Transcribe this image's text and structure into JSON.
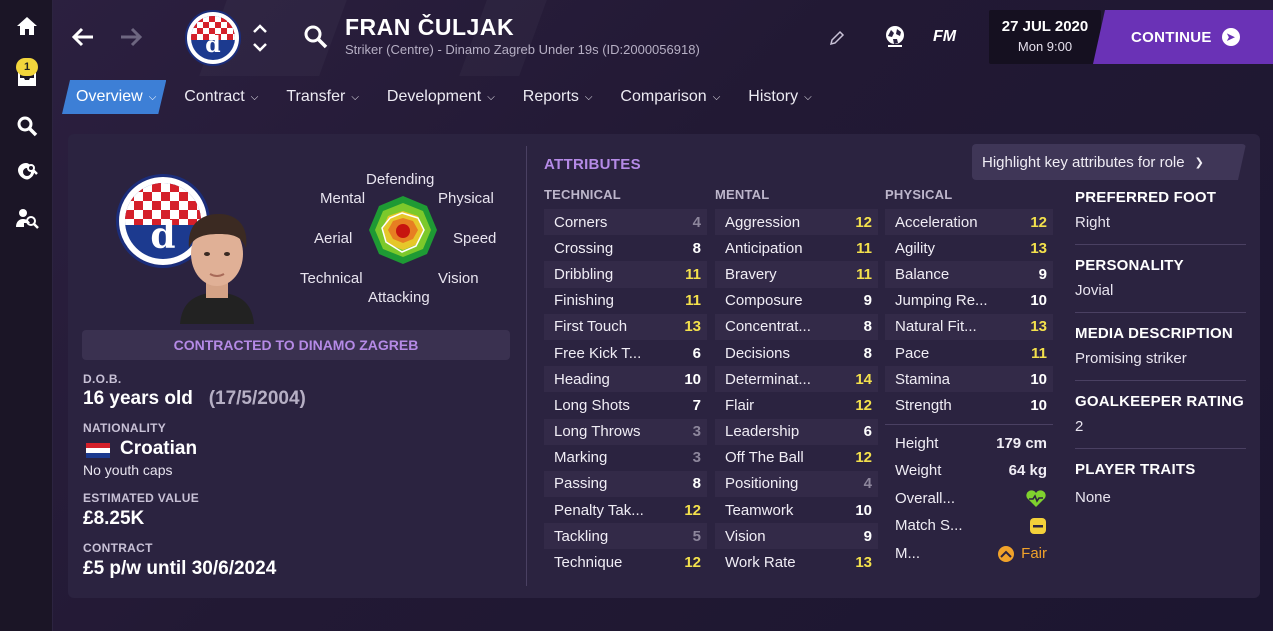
{
  "rail": {
    "badge_count": "1"
  },
  "header": {
    "player_name": "FRAN ČULJAK",
    "player_sub": "Striker (Centre) - Dinamo Zagreb Under 19s (ID:2000056918)",
    "fm_label": "FM",
    "date": "27 JUL 2020",
    "time": "Mon 9:00",
    "continue_label": "CONTINUE"
  },
  "tabs": [
    {
      "label": "Overview",
      "active": true
    },
    {
      "label": "Contract"
    },
    {
      "label": "Transfer"
    },
    {
      "label": "Development"
    },
    {
      "label": "Reports"
    },
    {
      "label": "Comparison"
    },
    {
      "label": "History"
    }
  ],
  "profile": {
    "club_badge_letter": "d",
    "radar_labels": {
      "defending": "Defending",
      "mental": "Mental",
      "physical": "Physical",
      "aerial": "Aerial",
      "speed": "Speed",
      "technical": "Technical",
      "vision": "Vision",
      "attacking": "Attacking"
    },
    "contract_banner": "CONTRACTED TO DINAMO ZAGREB",
    "dob_label": "D.O.B.",
    "age": "16 years old",
    "dob": "(17/5/2004)",
    "nationality_label": "NATIONALITY",
    "nationality": "Croatian",
    "youth_caps": "No youth caps",
    "value_label": "ESTIMATED VALUE",
    "value": "£8.25K",
    "contract_label": "CONTRACT",
    "contract": "£5 p/w until 30/6/2024"
  },
  "attributes": {
    "title": "ATTRIBUTES",
    "highlight_select": "Highlight key attributes for role",
    "technical_label": "TECHNICAL",
    "mental_label": "MENTAL",
    "physical_label": "PHYSICAL",
    "technical": [
      {
        "name": "Corners",
        "value": "4",
        "tone": "dim"
      },
      {
        "name": "Crossing",
        "value": "8",
        "tone": "white"
      },
      {
        "name": "Dribbling",
        "value": "11",
        "tone": "yellow"
      },
      {
        "name": "Finishing",
        "value": "11",
        "tone": "yellow"
      },
      {
        "name": "First Touch",
        "value": "13",
        "tone": "yellow"
      },
      {
        "name": "Free Kick T...",
        "value": "6",
        "tone": "white"
      },
      {
        "name": "Heading",
        "value": "10",
        "tone": "white"
      },
      {
        "name": "Long Shots",
        "value": "7",
        "tone": "white"
      },
      {
        "name": "Long Throws",
        "value": "3",
        "tone": "dim"
      },
      {
        "name": "Marking",
        "value": "3",
        "tone": "dim"
      },
      {
        "name": "Passing",
        "value": "8",
        "tone": "white"
      },
      {
        "name": "Penalty Tak...",
        "value": "12",
        "tone": "yellow"
      },
      {
        "name": "Tackling",
        "value": "5",
        "tone": "dim"
      },
      {
        "name": "Technique",
        "value": "12",
        "tone": "yellow"
      }
    ],
    "mental": [
      {
        "name": "Aggression",
        "value": "12",
        "tone": "yellow"
      },
      {
        "name": "Anticipation",
        "value": "11",
        "tone": "yellow"
      },
      {
        "name": "Bravery",
        "value": "11",
        "tone": "yellow"
      },
      {
        "name": "Composure",
        "value": "9",
        "tone": "white"
      },
      {
        "name": "Concentrat...",
        "value": "8",
        "tone": "white"
      },
      {
        "name": "Decisions",
        "value": "8",
        "tone": "white"
      },
      {
        "name": "Determinat...",
        "value": "14",
        "tone": "yellow"
      },
      {
        "name": "Flair",
        "value": "12",
        "tone": "yellow"
      },
      {
        "name": "Leadership",
        "value": "6",
        "tone": "white"
      },
      {
        "name": "Off The Ball",
        "value": "12",
        "tone": "yellow"
      },
      {
        "name": "Positioning",
        "value": "4",
        "tone": "dim"
      },
      {
        "name": "Teamwork",
        "value": "10",
        "tone": "white"
      },
      {
        "name": "Vision",
        "value": "9",
        "tone": "white"
      },
      {
        "name": "Work Rate",
        "value": "13",
        "tone": "yellow"
      }
    ],
    "physical": [
      {
        "name": "Acceleration",
        "value": "12",
        "tone": "yellow"
      },
      {
        "name": "Agility",
        "value": "13",
        "tone": "yellow"
      },
      {
        "name": "Balance",
        "value": "9",
        "tone": "white"
      },
      {
        "name": "Jumping Re...",
        "value": "10",
        "tone": "white"
      },
      {
        "name": "Natural Fit...",
        "value": "13",
        "tone": "yellow"
      },
      {
        "name": "Pace",
        "value": "11",
        "tone": "yellow"
      },
      {
        "name": "Stamina",
        "value": "10",
        "tone": "white"
      },
      {
        "name": "Strength",
        "value": "10",
        "tone": "white"
      }
    ],
    "extras": {
      "height_label": "Height",
      "height": "179 cm",
      "weight_label": "Weight",
      "weight": "64 kg",
      "overall_label": "Overall...",
      "match_label": "Match S...",
      "morale_label": "M...",
      "morale_value": "Fair"
    }
  },
  "side": {
    "preferred_foot_label": "PREFERRED FOOT",
    "preferred_foot": "Right",
    "personality_label": "PERSONALITY",
    "personality": "Jovial",
    "media_label": "MEDIA DESCRIPTION",
    "media": "Promising striker",
    "gk_label": "GOALKEEPER RATING",
    "gk": "2",
    "traits_label": "PLAYER TRAITS",
    "traits": "None"
  },
  "colors": {
    "accent_blue": "#3d7fd6",
    "continue_purple": "#6a32b6",
    "section_purple": "#b58ae6",
    "highlight_yellow": "#f3e04c",
    "overall_green": "#7fd12e",
    "match_yellow": "#f3d03a",
    "fair_orange": "#f0a22a"
  }
}
